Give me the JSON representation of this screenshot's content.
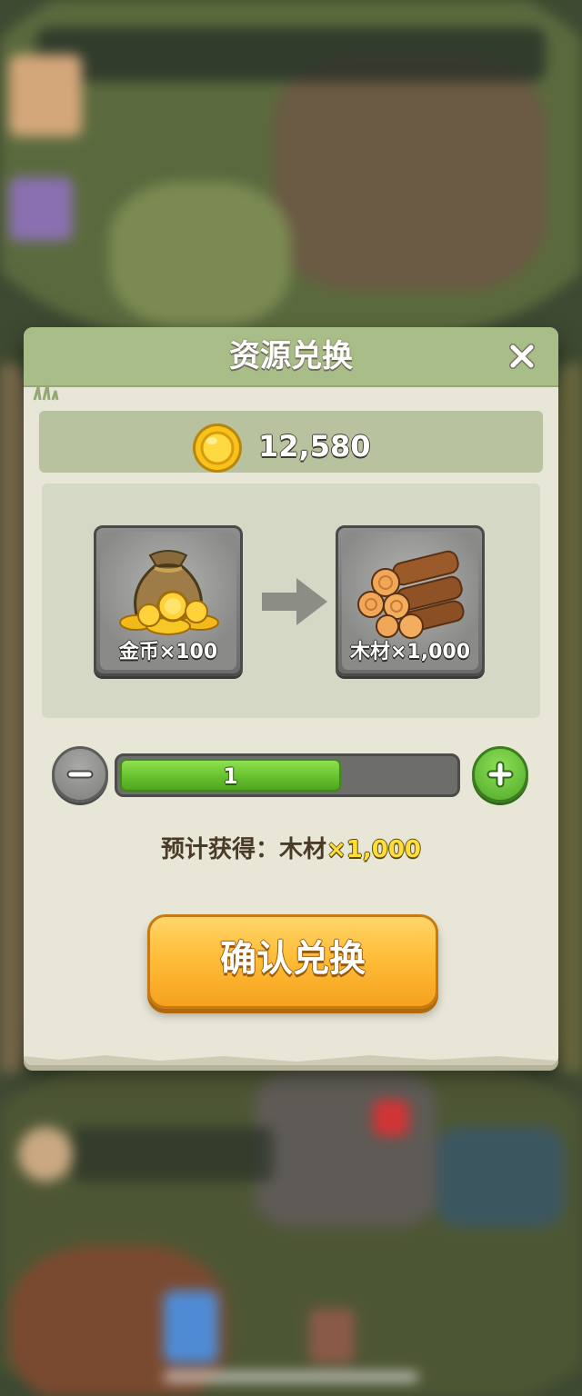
{
  "dialog": {
    "title": "资源兑换"
  },
  "balance": {
    "currency_icon": "gold-coin-icon",
    "value": "12,580"
  },
  "exchange": {
    "from": {
      "icon": "coin-bag-icon",
      "label": "金币×100"
    },
    "to": {
      "icon": "wood-logs-icon",
      "label": "木材×1,000"
    },
    "arrow_icon": "arrow-right-icon"
  },
  "quantity": {
    "value": "1",
    "fill_fraction": 0.66,
    "minus_icon": "minus-icon",
    "plus_icon": "plus-icon"
  },
  "reward": {
    "prefix": "预计获得：木材",
    "amount": "×1,000"
  },
  "confirm": {
    "label": "确认兑换"
  },
  "colors": {
    "header": "#a8bd87",
    "panel": "#e8e6d6",
    "confirm": "#ffbd38",
    "slider_fill": "#67c22d",
    "reward_highlight": "#ffde3a"
  }
}
